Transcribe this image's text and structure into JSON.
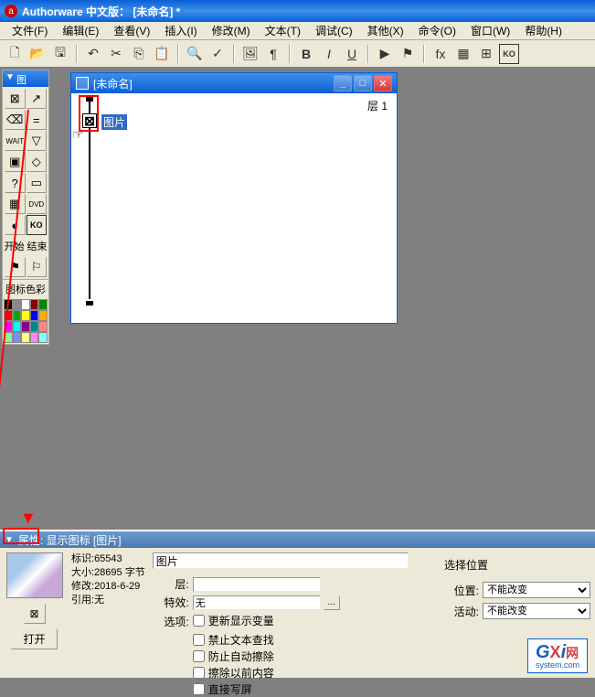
{
  "title": "Authorware 中文版： [未命名]  *",
  "menu": {
    "file": "文件(F)",
    "edit": "编辑(E)",
    "view": "查看(V)",
    "insert": "插入(I)",
    "modify": "修改(M)",
    "text": "文本(T)",
    "debug": "调试(C)",
    "other": "其他(X)",
    "cmd": "命令(O)",
    "window": "窗口(W)",
    "help": "帮助(H)"
  },
  "iconpanel": {
    "title": "图标",
    "start": "开始",
    "end": "结束",
    "colortitle": "图标色彩"
  },
  "flowwin": {
    "title": "[未命名]",
    "layer": "层 1",
    "nodelabel": "图片"
  },
  "props": {
    "title": "属性:  显示图标 [图片]",
    "id_lbl": "标识:",
    "id": "65543",
    "size_lbl": "大小:",
    "size": "28695 字节",
    "mod_lbl": "修改:",
    "mod": "2018-6-29",
    "ref_lbl": "引用:",
    "ref": "无",
    "open": "打开",
    "name": "图片",
    "layer_lbl": "层:",
    "layer_val": "",
    "fx_lbl": "特效:",
    "fx_val": "无",
    "opts_lbl": "选项:",
    "chk1": "更新显示变量",
    "chk2": "禁止文本查找",
    "chk3": "防止自动擦除",
    "chk4": "擦除以前内容",
    "chk5": "直接写屏",
    "selpos": "选择位置",
    "pos_lbl": "位置:",
    "pos_val": "不能改变",
    "act_lbl": "活动:",
    "act_val": "不能改变"
  },
  "colors": [
    "#000",
    "#888",
    "#fff",
    "#800",
    "#080",
    "#f00",
    "#0a0",
    "#ff0",
    "#00f",
    "#fa0",
    "#f0f",
    "#0ff",
    "#808",
    "#088",
    "#f88",
    "#8f8",
    "#88f",
    "#ff8",
    "#f8f",
    "#8ff"
  ],
  "watermark": {
    "g": "G",
    "x": "X",
    "i": "i",
    "net": "网",
    "sys": "system.com"
  }
}
